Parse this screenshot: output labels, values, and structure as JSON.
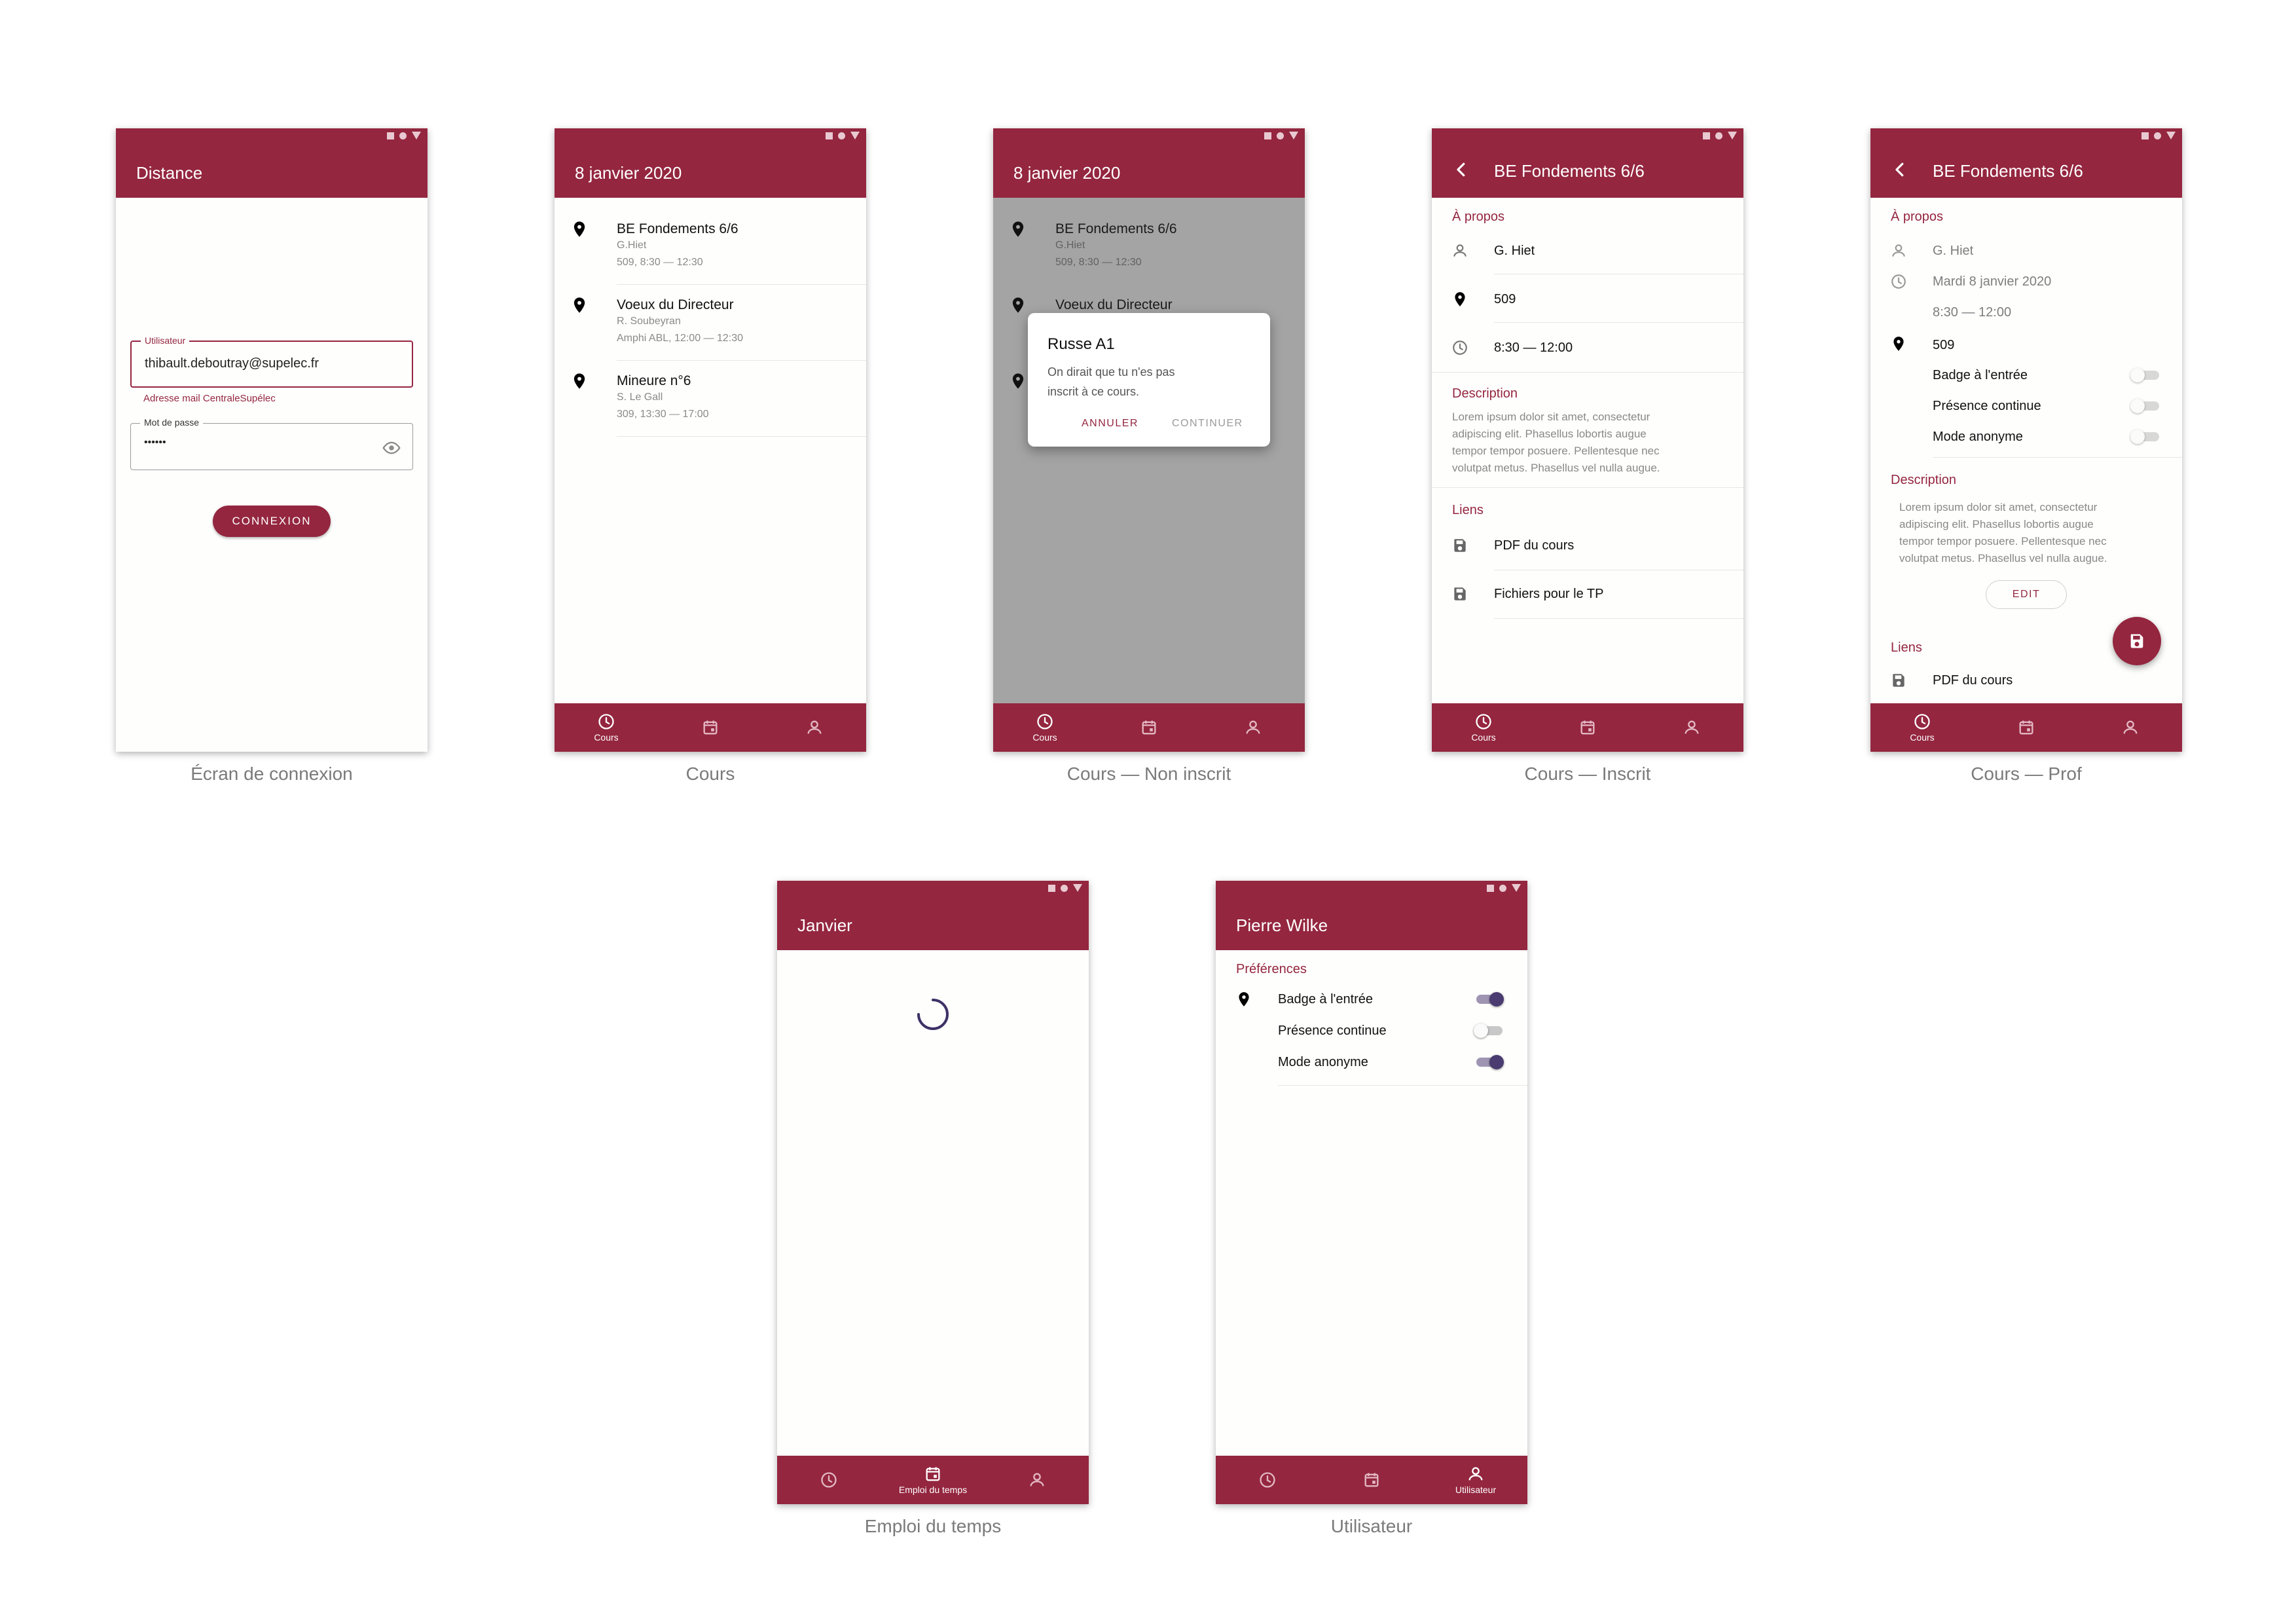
{
  "colors": {
    "primary": "#94263f",
    "accent": "#4a3b70",
    "muted": "#8a8a8a"
  },
  "icons": {
    "location": "map-pin-icon",
    "clock": "clock-icon",
    "calendar": "calendar-icon",
    "person": "person-icon",
    "save": "floppy-disk-icon",
    "back": "chevron-left-icon",
    "visibility": "eye-icon",
    "status": [
      "square-icon",
      "circle-icon",
      "triangle-icon"
    ]
  },
  "screens": {
    "login": {
      "title": "Distance",
      "user_label": "Utilisateur",
      "user_value": "thibault.deboutray@supelec.fr",
      "user_helper": "Adresse mail CentraleSupélec",
      "password_label": "Mot de passe",
      "password_value": "••••••",
      "button": "CONNEXION",
      "caption": "Écran de connexion"
    },
    "courses": {
      "title": "8 janvier 2020",
      "items": [
        {
          "title": "BE Fondements 6/6",
          "teacher": "G.Hiet",
          "details": "509, 8:30 — 12:30",
          "pin_color": "#777777"
        },
        {
          "title": "Voeux du Directeur",
          "teacher": "R. Soubeyran",
          "details": "Amphi ABL, 12:00 — 12:30",
          "pin_color": "#2c4f7c"
        },
        {
          "title": "Mineure n°6",
          "teacher": "S. Le Gall",
          "details": "309, 13:30 — 17:00",
          "pin_color": "#94263f"
        }
      ],
      "caption": "Cours"
    },
    "not_enrolled": {
      "title": "8 janvier 2020",
      "dialog_title": "Russe A1",
      "dialog_text_1": "On dirait que tu n'es pas",
      "dialog_text_2": "inscrit à ce cours.",
      "cancel": "ANNULER",
      "continue": "CONTINUER",
      "caption": "Cours — Non inscrit"
    },
    "enrolled": {
      "title": "BE Fondements 6/6",
      "about": "À propos",
      "teacher": "G. Hiet",
      "room": "509",
      "time": "8:30 — 12:00",
      "description_title": "Description",
      "description": [
        "Lorem ipsum dolor sit amet, consectetur",
        "adipiscing elit. Phasellus lobortis augue",
        "tempor tempor posuere. Pellentesque nec",
        "volutpat metus. Phasellus vel nulla augue."
      ],
      "links_title": "Liens",
      "link_1": "PDF du cours",
      "link_2": "Fichiers pour le TP",
      "caption": "Cours — Inscrit"
    },
    "prof": {
      "title": "BE Fondements 6/6",
      "about": "À propos",
      "teacher": "G. Hiet",
      "date": "Mardi 8 janvier 2020",
      "time": "8:30 — 12:00",
      "room": "509",
      "toggles": [
        {
          "label": "Badge à l'entrée",
          "on": false
        },
        {
          "label": "Présence continue",
          "on": false
        },
        {
          "label": "Mode anonyme",
          "on": false
        }
      ],
      "description_title": "Description",
      "description": [
        "Lorem ipsum dolor sit amet, consectetur",
        "adipiscing elit. Phasellus lobortis augue",
        "tempor tempor posuere. Pellentesque nec",
        "volutpat metus. Phasellus vel nulla augue."
      ],
      "edit": "EDIT",
      "links_title": "Liens",
      "link_1": "PDF du cours",
      "caption": "Cours — Prof"
    },
    "schedule": {
      "title": "Janvier",
      "nav_label": "Emploi du temps",
      "caption": "Emploi du temps"
    },
    "user": {
      "title": "Pierre Wilke",
      "preferences": "Préférences",
      "toggles": [
        {
          "label": "Badge à l'entrée",
          "on": true
        },
        {
          "label": "Présence continue",
          "on": false
        },
        {
          "label": "Mode anonyme",
          "on": true
        }
      ],
      "nav_label": "Utilisateur",
      "caption": "Utilisateur"
    }
  },
  "nav": {
    "courses": "Cours"
  }
}
